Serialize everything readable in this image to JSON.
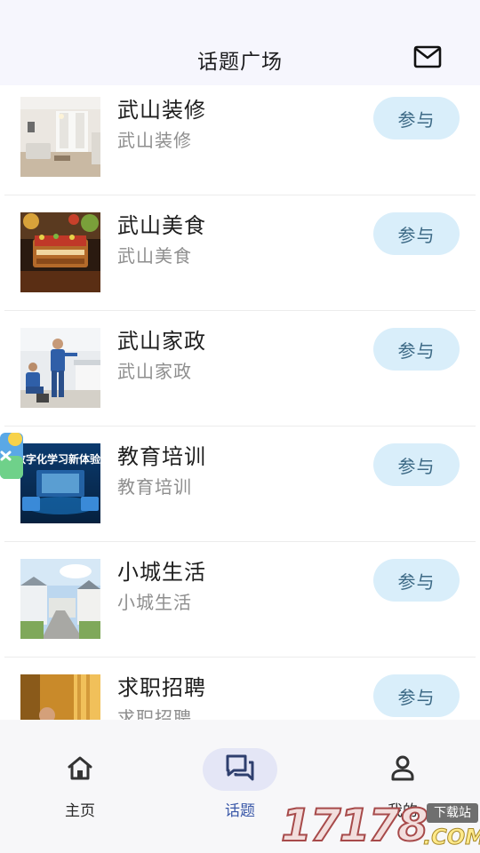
{
  "header": {
    "title": "话题广场",
    "mail_icon": "mail-icon"
  },
  "topics": [
    {
      "title": "武山装修",
      "subtitle": "武山装修",
      "action": "参与",
      "image": "living-room-photo"
    },
    {
      "title": "武山美食",
      "subtitle": "武山美食",
      "action": "参与",
      "image": "food-dish-photo"
    },
    {
      "title": "武山家政",
      "subtitle": "武山家政",
      "action": "参与",
      "image": "housekeeping-workers-photo"
    },
    {
      "title": "教育培训",
      "subtitle": "教育培训",
      "action": "参与",
      "image": "digital-learning-banner",
      "image_text": "数字化学习新体验"
    },
    {
      "title": "小城生活",
      "subtitle": "小城生活",
      "action": "参与",
      "image": "town-street-photo"
    },
    {
      "title": "求职招聘",
      "subtitle": "求职招聘",
      "action": "参与",
      "image": "job-interview-photo"
    }
  ],
  "tabbar": {
    "items": [
      {
        "label": "主页",
        "icon": "home-icon",
        "active": false
      },
      {
        "label": "话题",
        "icon": "chat-bubbles-icon",
        "active": true
      },
      {
        "label": "我的",
        "icon": "person-icon",
        "active": false
      }
    ]
  },
  "watermark": {
    "number": "17178",
    "tag": "下载站",
    "suffix": ".COM"
  },
  "colors": {
    "header_bg": "#f6f6fd",
    "join_button_bg": "#d9eefa",
    "join_button_text": "#3d6a86",
    "active_tab": "#3a58a8",
    "active_tab_bg": "#e4e6f6"
  }
}
